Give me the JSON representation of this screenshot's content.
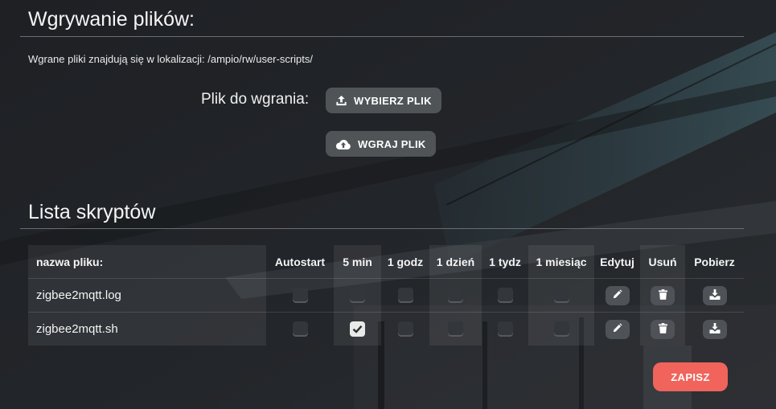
{
  "upload": {
    "title": "Wgrywanie plików:",
    "info": "Wgrane pliki znajdują się w lokalizacji: /ampio/rw/user-scripts/",
    "file_label": "Plik do wgrania:",
    "choose_button": "WYBIERZ PLIK",
    "upload_button": "WGRAJ PLIK"
  },
  "scripts": {
    "title": "Lista skryptów",
    "columns": [
      "nazwa pliku:",
      "Autostart",
      "5 min",
      "1 godz",
      "1 dzień",
      "1 tydz",
      "1 miesiąc",
      "Edytuj",
      "Usuń",
      "Pobierz"
    ],
    "rows": [
      {
        "name": "zigbee2mqtt.log",
        "autostart": false,
        "min5": false,
        "hour1": false,
        "day1": false,
        "week1": false,
        "month1": false
      },
      {
        "name": "zigbee2mqtt.sh",
        "autostart": false,
        "min5": true,
        "hour1": false,
        "day1": false,
        "week1": false,
        "month1": false
      }
    ]
  },
  "save_button": "ZAPISZ",
  "icons": {
    "choose": "upload-icon",
    "upload": "cloud-upload-icon",
    "edit": "pencil-icon",
    "delete": "trash-icon",
    "download": "download-icon",
    "check": "checkmark-icon"
  },
  "colors": {
    "save": "#f0645c",
    "button": "#505457"
  }
}
